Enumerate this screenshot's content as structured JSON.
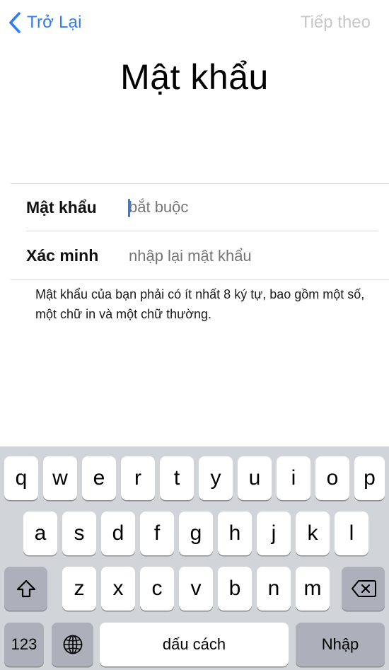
{
  "nav": {
    "back_label": "Trở Lại",
    "next_label": "Tiếp theo"
  },
  "title": "Mật khẩu",
  "form": {
    "password_label": "Mật khẩu",
    "password_placeholder": "bắt buộc",
    "verify_label": "Xác minh",
    "verify_placeholder": "nhập lại mật khẩu"
  },
  "hint": "Mật khẩu của bạn phải có ít nhất 8 ký tự, bao gồm một số, một chữ in và một chữ thường.",
  "keyboard": {
    "row1": [
      "q",
      "w",
      "e",
      "r",
      "t",
      "y",
      "u",
      "i",
      "o",
      "p"
    ],
    "row2": [
      "a",
      "s",
      "d",
      "f",
      "g",
      "h",
      "j",
      "k",
      "l"
    ],
    "row3": [
      "z",
      "x",
      "c",
      "v",
      "b",
      "n",
      "m"
    ],
    "numbers_label": "123",
    "space_label": "dấu cách",
    "return_label": "Nhập",
    "shift_icon": "shift-arrow-icon",
    "globe_icon": "globe-icon",
    "delete_icon": "backspace-icon"
  },
  "colors": {
    "accent": "#2f7cf6",
    "disabled": "#c6c6cb",
    "keyboard_bg": "#d1d4d9",
    "key_dark": "#abb0ba"
  }
}
